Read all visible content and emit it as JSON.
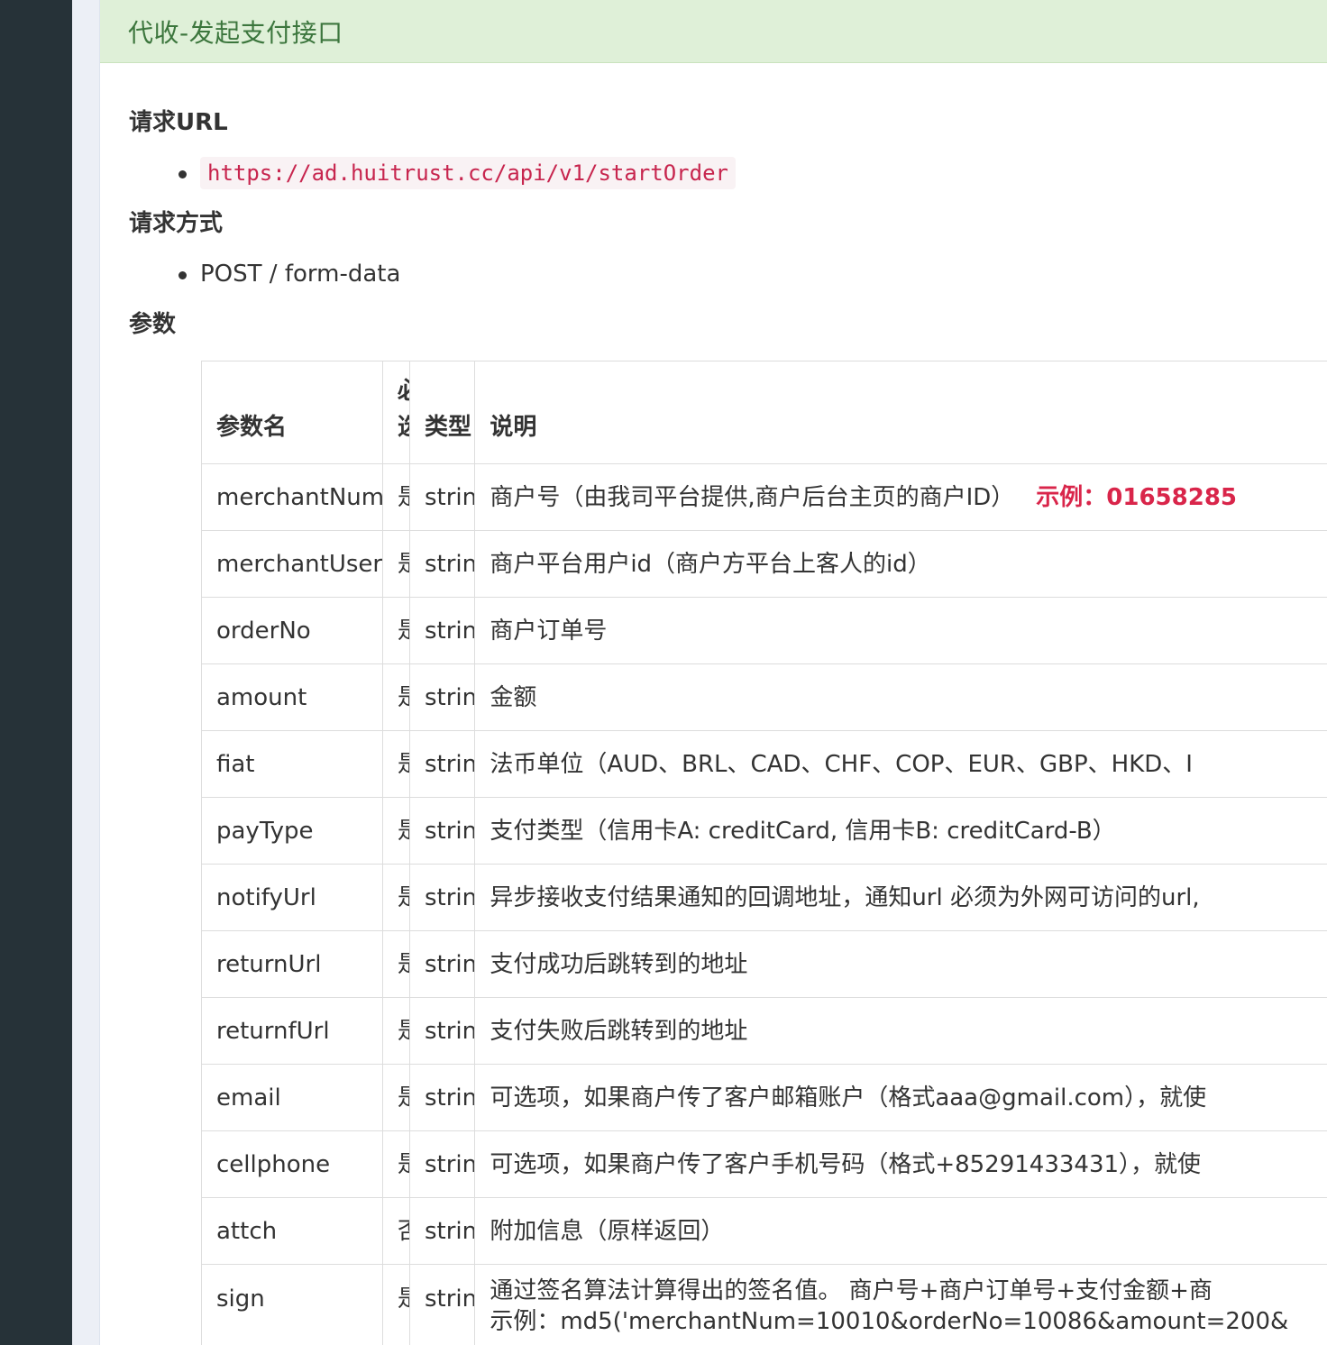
{
  "panel": {
    "title": "代收-发起支付接口"
  },
  "sections": {
    "url_heading": "请求URL",
    "url_value": "https://ad.huitrust.cc/api/v1/startOrder",
    "method_heading": "请求方式",
    "method_value": "POST / form-data",
    "params_heading": "参数"
  },
  "table": {
    "headers": {
      "name": "参数名",
      "required_line1": "必",
      "required_line2": "选",
      "type": "类型",
      "desc": "说明"
    },
    "rows": [
      {
        "name": "merchantNum",
        "required": "是",
        "type": "string",
        "desc": "商户号（由我司平台提供,商户后台主页的商户ID）",
        "example": "示例：01658285"
      },
      {
        "name": "merchantUserid",
        "required": "是",
        "type": "string",
        "desc": "商户平台用户id（商户方平台上客人的id）"
      },
      {
        "name": "orderNo",
        "required": "是",
        "type": "string",
        "desc": "商户订单号"
      },
      {
        "name": "amount",
        "required": "是",
        "type": "string",
        "desc": "金额"
      },
      {
        "name": "fiat",
        "required": "是",
        "type": "string",
        "desc": "法币单位（AUD、BRL、CAD、CHF、COP、EUR、GBP、HKD、I"
      },
      {
        "name": "payType",
        "required": "是",
        "type": "string",
        "desc": "支付类型（信用卡A: creditCard, 信用卡B: creditCard-B）"
      },
      {
        "name": "notifyUrl",
        "required": "是",
        "type": "string",
        "desc": "异步接收支付结果通知的回调地址，通知url 必须为外网可访问的url,"
      },
      {
        "name": "returnUrl",
        "required": "是",
        "type": "string",
        "desc": "支付成功后跳转到的地址"
      },
      {
        "name": "returnfUrl",
        "required": "是",
        "type": "string",
        "desc": "支付失败后跳转到的地址"
      },
      {
        "name": "email",
        "required": "是",
        "type": "string",
        "desc": "可选项，如果商户传了客户邮箱账户（格式aaa@gmail.com），就使"
      },
      {
        "name": "cellphone",
        "required": "是",
        "type": "string",
        "desc": "可选项，如果商户传了客户手机号码（格式+85291433431），就使"
      },
      {
        "name": "attch",
        "required": "否",
        "type": "string",
        "desc": "附加信息（原样返回）"
      },
      {
        "name": "sign",
        "required": "是",
        "type": "string",
        "desc": "通过签名算法计算得出的签名值。 商户号+商户订单号+支付金额+商",
        "desc2": "示例：md5('merchantNum=10010&orderNo=10086&amount=200&"
      }
    ]
  }
}
